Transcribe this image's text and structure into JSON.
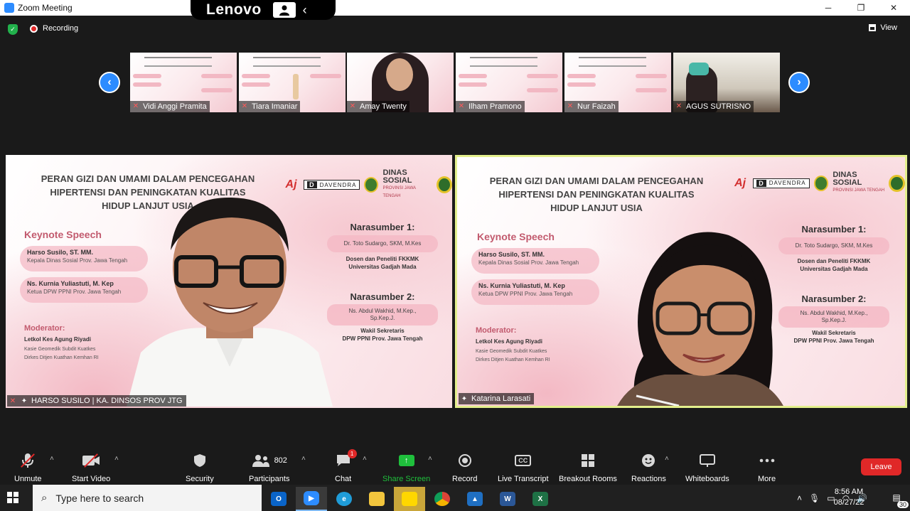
{
  "window": {
    "title": "Zoom Meeting",
    "controls": [
      "─",
      "❐",
      "✕"
    ]
  },
  "lenovo": {
    "brand": "Lenovo",
    "chevron": "‹"
  },
  "topbar": {
    "recording_label": "Recording",
    "view_label": "View"
  },
  "strip": {
    "prev_arrow": "‹",
    "next_arrow": "›",
    "participants": [
      {
        "name": "Vidi Anggi Pramita",
        "kind": "slide"
      },
      {
        "name": "Tiara Imaniar",
        "kind": "slide"
      },
      {
        "name": "Amay Twenty",
        "kind": "camera"
      },
      {
        "name": "Ilham Pramono",
        "kind": "slide"
      },
      {
        "name": "Nur Faizah",
        "kind": "slide"
      },
      {
        "name": "AGUS SUTRISNO",
        "kind": "camera"
      }
    ]
  },
  "slide": {
    "title": "PERAN GIZI DAN UMAMI DALAM PENCEGAHAN HIPERTENSI DAN PENINGKATAN KUALITAS HIDUP LANJUT USIA",
    "title_line1": "PERAN GIZI DAN UMAMI DALAM PENCEGAHAN",
    "title_line2": "HIPERTENSI DAN PENINGKATAN KUALITAS",
    "title_line3": "HIDUP LANJUT USIA",
    "keynote_heading": "Keynote Speech",
    "keynote": [
      {
        "name": "Harso Susilo, ST. MM.",
        "role": "Kepala Dinas Sosial Prov. Jawa Tengah"
      },
      {
        "name": "Ns. Kurnia Yuliastuti, M. Kep",
        "role": "Ketua DPW PPNI Prov. Jawa Tengah"
      }
    ],
    "moderator_heading": "Moderator:",
    "moderator_name": "Letkol Kes Agung Riyadi",
    "moderator_role1": "Kasie Geomedik Subdit Kuatkes",
    "moderator_role2": "Dirkes Ditjen Kuathan Kemhan RI",
    "speaker1_heading": "Narasumber 1:",
    "speaker1_name": "Dr. Toto Sudargo, SKM, M.Kes",
    "speaker1_role1": "Dosen dan Peneliti FKKMK",
    "speaker1_role2": "Universitas Gadjah Mada",
    "speaker2_heading": "Narasumber 2:",
    "speaker2_name1": "Ns. Abdul Wakhid, M.Kep.,",
    "speaker2_name2": "Sp.Kep.J.",
    "speaker2_role1": "Wakil Sekretaris",
    "speaker2_role2": "DPW PPNI Prov. Jawa Tengah",
    "logo_davendra": "DAVENDRA",
    "logo_d": "D",
    "logo_dinsos": "DINAS SOSIAL",
    "logo_dinsos_sub": "PROVINSI JAWA TENGAH",
    "logo_aj": "Aj"
  },
  "tiles": {
    "left_name": "HARSO SUSILO | KA. DINSOS PROV JTG",
    "right_name": "Katarina Larasati"
  },
  "toolbar": {
    "unmute": "Unmute",
    "start_video": "Start Video",
    "security": "Security",
    "participants": "Participants",
    "participants_count": "802",
    "chat": "Chat",
    "chat_badge": "1",
    "share_screen": "Share Screen",
    "record": "Record",
    "live_transcript": "Live Transcript",
    "breakout_rooms": "Breakout Rooms",
    "reactions": "Reactions",
    "whiteboards": "Whiteboards",
    "more": "More",
    "leave": "Leave",
    "cc": "CC",
    "caret": "˄"
  },
  "taskbar": {
    "search_placeholder": "Type here to search",
    "time": "8:56 AM",
    "date": "08/27/22",
    "notifications": "30",
    "apps": [
      "outlook",
      "zoom",
      "edge",
      "file-explorer",
      "sticky-notes",
      "chrome",
      "photos",
      "word",
      "excel"
    ]
  },
  "colors": {
    "accent": "#2d8cff",
    "leave": "#e02828",
    "share": "#1fbf3c",
    "active_border": "#e3ef8c",
    "slide_pink": "#f4bac6"
  }
}
